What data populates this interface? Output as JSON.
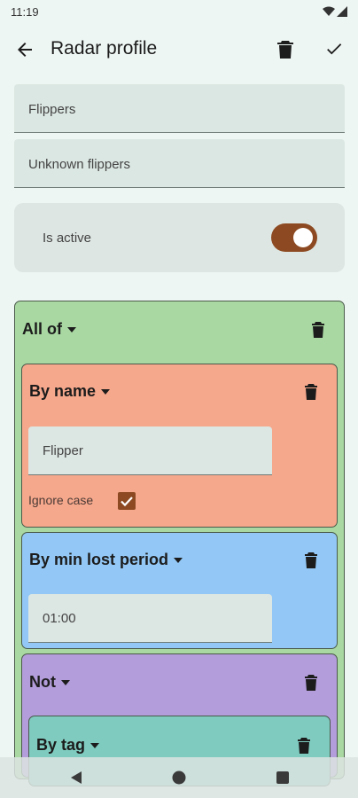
{
  "status_bar": {
    "time": "11:19",
    "wifi_icon": "wifi-icon",
    "signal_icon": "signal-icon"
  },
  "app_bar": {
    "title": "Radar profile",
    "back_icon": "arrow-left-icon",
    "delete_icon": "trash-icon",
    "save_icon": "check-icon"
  },
  "fields": {
    "name_value": "Flippers",
    "description_value": "Unknown flippers"
  },
  "active": {
    "label": "Is active",
    "value": true
  },
  "filter": {
    "all_of": {
      "title": "All of"
    },
    "by_name": {
      "title": "By name",
      "value": "Flipper",
      "ignore_case_label": "Ignore case",
      "ignore_case_checked": true
    },
    "by_min_lost_period": {
      "title": "By min lost period",
      "value": "01:00"
    },
    "not": {
      "title": "Not"
    },
    "by_tag": {
      "title": "By tag"
    }
  },
  "nav_bar": {
    "back": "nav-back-icon",
    "home": "nav-home-icon",
    "recents": "nav-recents-icon"
  },
  "colors": {
    "accent": "#8d4a22",
    "all_of": "#a9d8a2",
    "by_name": "#f6a88c",
    "by_min_lost_period": "#93c8f6",
    "not": "#b39ddb",
    "by_tag": "#7fcbbf"
  }
}
